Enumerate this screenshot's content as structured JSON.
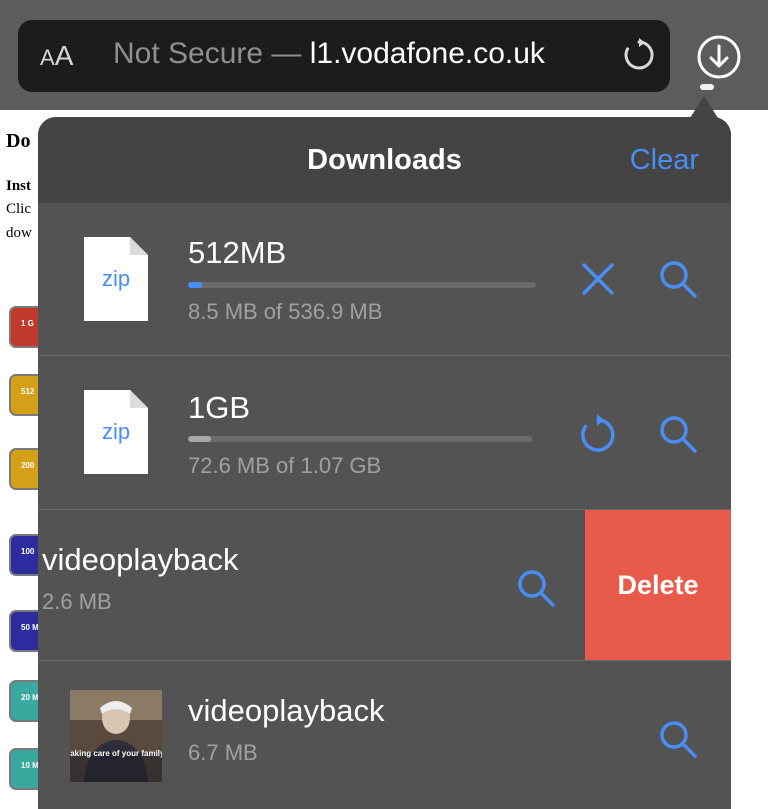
{
  "browser": {
    "aa_small": "A",
    "aa_big": "A",
    "url_prefix": "Not Secure — ",
    "url_host": "l1.vodafone.co.uk"
  },
  "webpage": {
    "title_fragment": "Do",
    "inst_fragment": "Inst",
    "line1_fragment": "Clic",
    "line2_fragment": "dow",
    "pills": [
      {
        "label": "1 G",
        "color": "#c0392b"
      },
      {
        "label": "512",
        "color": "#d4a017"
      },
      {
        "label": "200",
        "color": "#d4a017"
      },
      {
        "label": "100",
        "color": "#2c2c9e"
      },
      {
        "label": "50 M",
        "color": "#2c2c9e"
      },
      {
        "label": "20 M",
        "color": "#3aa89e"
      },
      {
        "label": "10 M",
        "color": "#3aa89e"
      }
    ]
  },
  "downloads": {
    "title": "Downloads",
    "clear_label": "Clear",
    "items": [
      {
        "name": "512MB",
        "size": "8.5 MB of 536.9 MB",
        "progress": 0.016,
        "type": "zip",
        "action": "cancel"
      },
      {
        "name": "1GB",
        "size": "72.6 MB of 1.07 GB",
        "progress": 0.068,
        "type": "zip",
        "action": "resume"
      },
      {
        "name": "videoplayback",
        "size": "2.6 MB",
        "delete_label": "Delete"
      },
      {
        "name": "videoplayback",
        "size": "6.7 MB",
        "thumb_caption": "taking care of your family"
      }
    ],
    "zip_label": "zip",
    "accent_color": "#4a8ef5",
    "delete_color": "#e85a4a"
  }
}
